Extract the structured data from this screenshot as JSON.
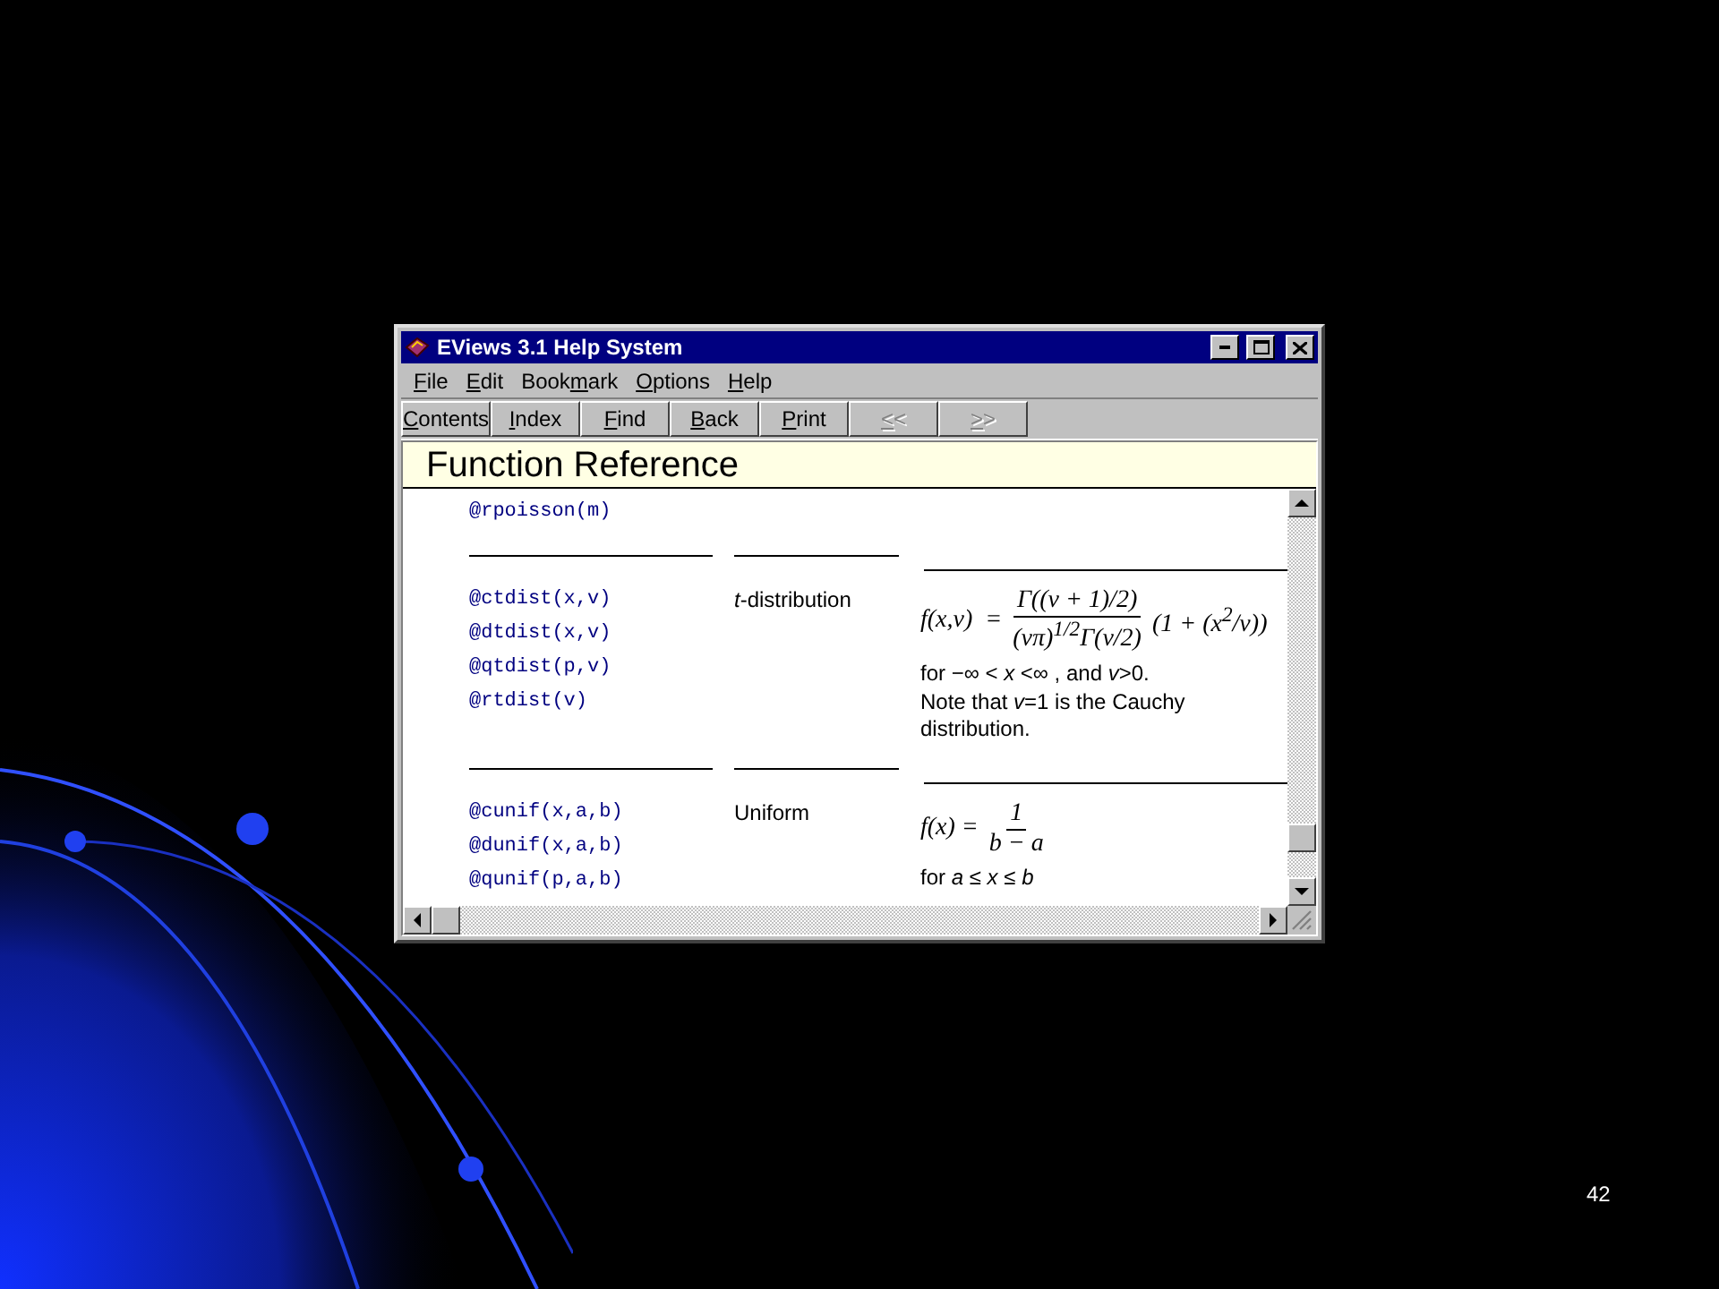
{
  "window": {
    "title": "EViews 3.1 Help System"
  },
  "menu": [
    {
      "label": "File"
    },
    {
      "label": "Edit"
    },
    {
      "label": "Bookmark"
    },
    {
      "label": "Options"
    },
    {
      "label": "Help"
    }
  ],
  "toolbar": [
    {
      "label": "Contents",
      "disabled": false
    },
    {
      "label": "Index",
      "disabled": false
    },
    {
      "label": "Find",
      "disabled": false
    },
    {
      "label": "Back",
      "disabled": false
    },
    {
      "label": "Print",
      "disabled": false
    },
    {
      "label": "<<",
      "disabled": true
    },
    {
      "label": ">>",
      "disabled": true
    }
  ],
  "topic_title": "Function Reference",
  "entries": [
    {
      "functions": [
        "@rpoisson(m)"
      ]
    },
    {
      "functions": [
        "@ctdist(x,v)",
        "@dtdist(x,v)",
        "@qtdist(p,v)",
        "@rtdist(v)"
      ],
      "name": "*t*-distribution",
      "formula": {
        "kind": "fraction",
        "lhs": "f(x,v)  =",
        "numerator": "Γ((v + 1)/2)",
        "denominator": "(vπ)$^{1/2}$Γ(v/2)",
        "tail": "(1 + (x$^{2}$/v))"
      },
      "notes": [
        "for −∞ < *x* <∞ , and *v*>0.",
        "Note that *v*=1 is the Cauchy distribution."
      ]
    },
    {
      "functions": [
        "@cunif(x,a,b)",
        "@dunif(x,a,b)",
        "@qunif(p,a,b)"
      ],
      "name": "Uniform",
      "formula": {
        "kind": "fraction",
        "lhs": "f(x) =",
        "numerator": "1",
        "denominator": "b − a"
      },
      "notes": [
        "for *a* ≤ *x* ≤ *b*"
      ]
    }
  ],
  "slide_number": "42"
}
